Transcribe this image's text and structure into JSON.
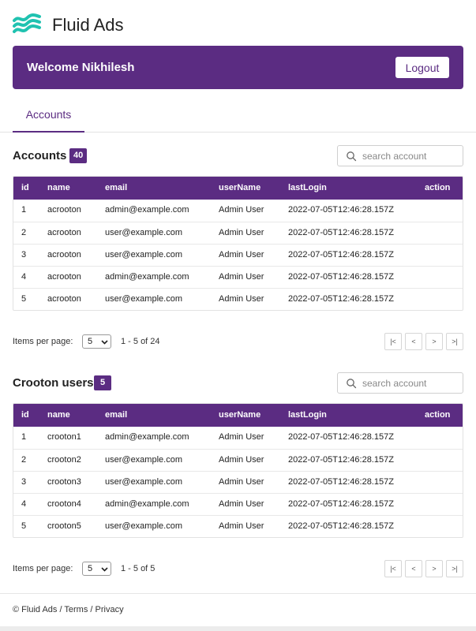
{
  "app": {
    "title": "Fluid Ads",
    "brand_color": "#5b2c82",
    "logo_color": "#20c2b0"
  },
  "welcome": {
    "text": "Welcome Nikhilesh",
    "logout_label": "Logout"
  },
  "tabs": [
    {
      "label": "Accounts",
      "active": true
    }
  ],
  "columns": [
    "id",
    "name",
    "email",
    "userName",
    "lastLogin",
    "action"
  ],
  "accounts": {
    "title": "Accounts",
    "count": "40",
    "search_placeholder": "search account",
    "rows": [
      {
        "id": "1",
        "name": "acrooton",
        "email": "admin@example.com",
        "userName": "Admin User",
        "lastLogin": "2022-07-05T12:46:28.157Z"
      },
      {
        "id": "2",
        "name": "acrooton",
        "email": "user@example.com",
        "userName": "Admin User",
        "lastLogin": "2022-07-05T12:46:28.157Z"
      },
      {
        "id": "3",
        "name": "acrooton",
        "email": "user@example.com",
        "userName": "Admin User",
        "lastLogin": "2022-07-05T12:46:28.157Z"
      },
      {
        "id": "4",
        "name": "acrooton",
        "email": "admin@example.com",
        "userName": "Admin User",
        "lastLogin": "2022-07-05T12:46:28.157Z"
      },
      {
        "id": "5",
        "name": "acrooton",
        "email": "user@example.com",
        "userName": "Admin User",
        "lastLogin": "2022-07-05T12:46:28.157Z"
      }
    ],
    "pager": {
      "items_per_page_label": "Items per page:",
      "items_per_page": "5",
      "range": "1 - 5 of 24"
    }
  },
  "crooton_users": {
    "title": "Crooton users",
    "count": "5",
    "search_placeholder": "search account",
    "rows": [
      {
        "id": "1",
        "name": "crooton1",
        "email": "admin@example.com",
        "userName": "Admin User",
        "lastLogin": "2022-07-05T12:46:28.157Z"
      },
      {
        "id": "2",
        "name": "crooton2",
        "email": "user@example.com",
        "userName": "Admin User",
        "lastLogin": "2022-07-05T12:46:28.157Z"
      },
      {
        "id": "3",
        "name": "crooton3",
        "email": "user@example.com",
        "userName": "Admin User",
        "lastLogin": "2022-07-05T12:46:28.157Z"
      },
      {
        "id": "4",
        "name": "crooton4",
        "email": "admin@example.com",
        "userName": "Admin User",
        "lastLogin": "2022-07-05T12:46:28.157Z"
      },
      {
        "id": "5",
        "name": "crooton5",
        "email": "user@example.com",
        "userName": "Admin User",
        "lastLogin": "2022-07-05T12:46:28.157Z"
      }
    ],
    "pager": {
      "items_per_page_label": "Items per page:",
      "items_per_page": "5",
      "range": "1 - 5 of 5"
    }
  },
  "pager_buttons": {
    "first": "|<",
    "prev": "<",
    "next": ">",
    "last": ">|"
  },
  "footer": {
    "copyright": "© Fluid Ads",
    "sep": "/",
    "terms": "Terms",
    "privacy": "Privacy"
  }
}
